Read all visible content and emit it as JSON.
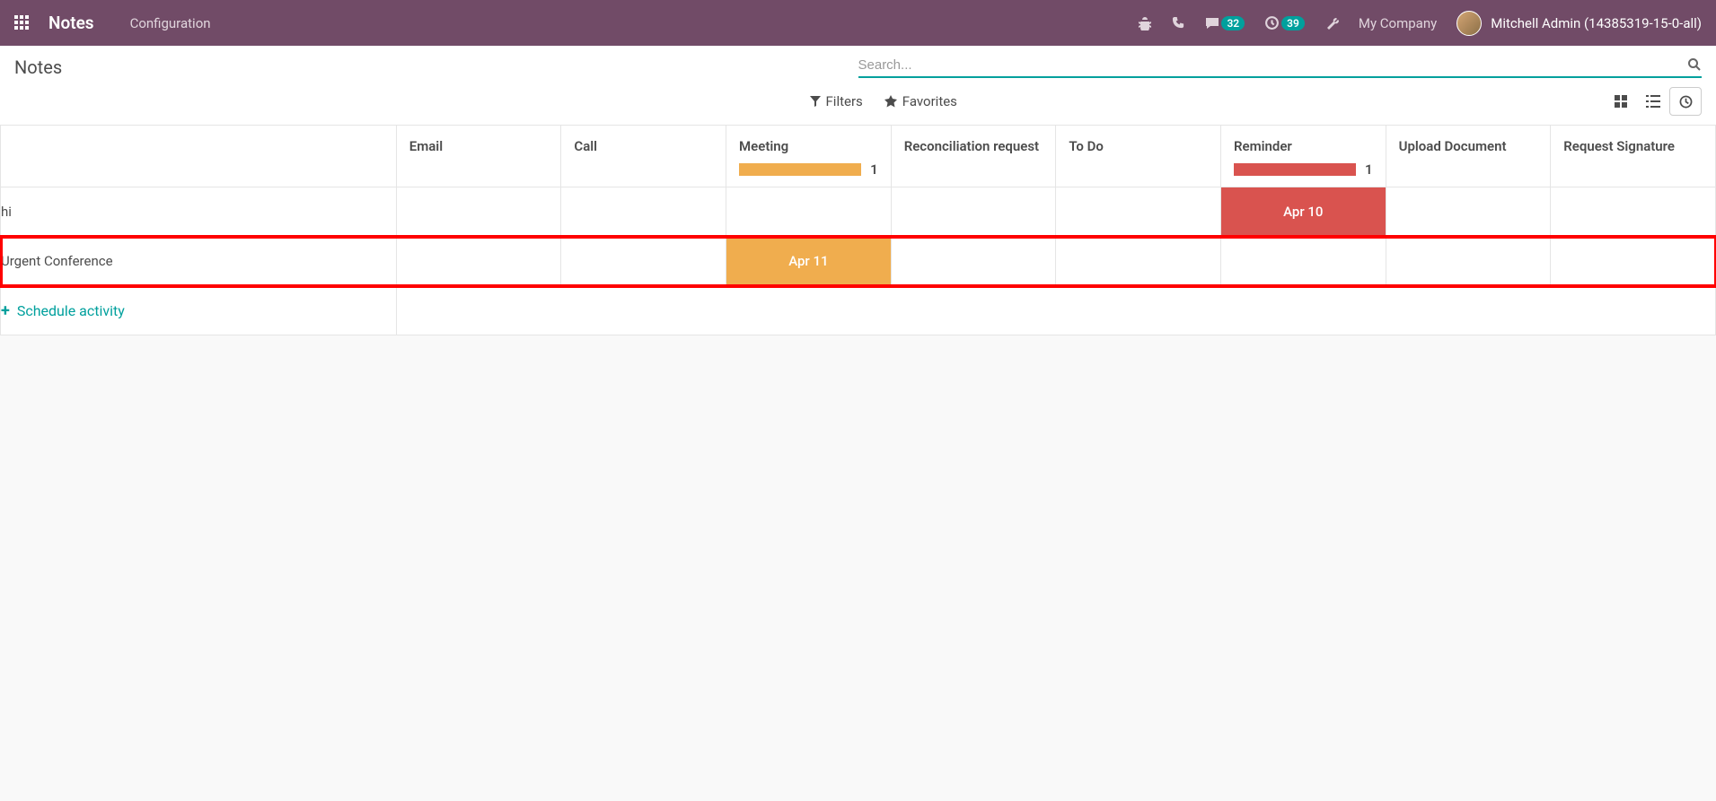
{
  "navbar": {
    "brand": "Notes",
    "menu": {
      "configuration": "Configuration"
    },
    "messages_count": "32",
    "activities_count": "39",
    "company": "My Company",
    "username": "Mitchell Admin (14385319-15-0-all)"
  },
  "control_panel": {
    "breadcrumb": "Notes",
    "search_placeholder": "Search...",
    "filters_label": "Filters",
    "favorites_label": "Favorites"
  },
  "columns": {
    "name": "",
    "email": "Email",
    "call": "Call",
    "meeting": "Meeting",
    "reconciliation": "Reconciliation request",
    "todo": "To Do",
    "reminder": "Reminder",
    "upload": "Upload Document",
    "signature": "Request Signature"
  },
  "column_counts": {
    "meeting": "1",
    "reminder": "1"
  },
  "rows": [
    {
      "name": "hi",
      "reminder": "Apr 10"
    },
    {
      "name": "Urgent Conference",
      "meeting": "Apr 11"
    }
  ],
  "schedule_label": "Schedule activity"
}
